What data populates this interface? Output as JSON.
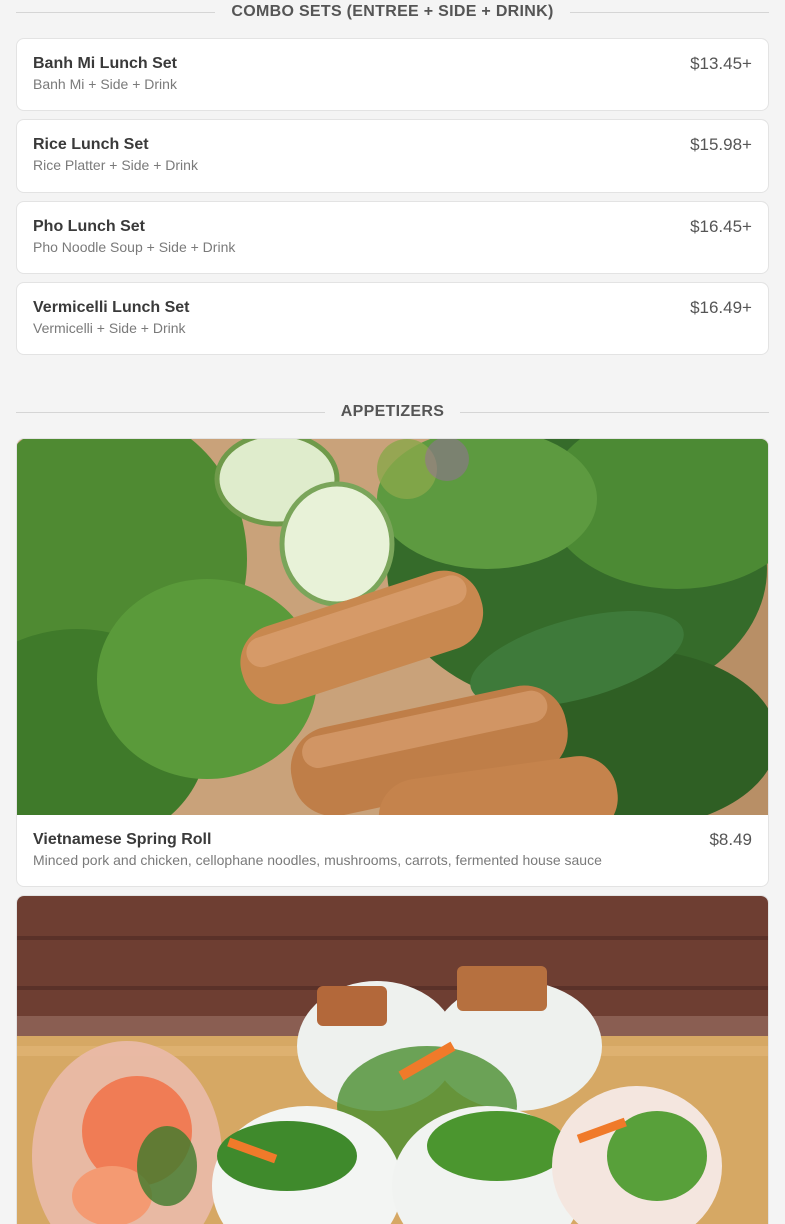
{
  "sections": {
    "combo": {
      "title": "COMBO SETS (ENTREE + SIDE + DRINK)"
    },
    "appetizers": {
      "title": "APPETIZERS"
    }
  },
  "combo_items": [
    {
      "name": "Banh Mi Lunch Set",
      "description": "Banh Mi + Side + Drink",
      "price": "$13.45+"
    },
    {
      "name": "Rice Lunch Set",
      "description": "Rice Platter + Side + Drink",
      "price": "$15.98+"
    },
    {
      "name": "Pho Lunch Set",
      "description": "Pho Noodle Soup + Side + Drink",
      "price": "$16.45+"
    },
    {
      "name": "Vermicelli Lunch Set",
      "description": "Vermicelli + Side + Drink",
      "price": "$16.49+"
    }
  ],
  "appetizer_items": [
    {
      "name": "Vietnamese Spring Roll",
      "description": "Minced pork and chicken, cellophane noodles, mushrooms, carrots, fermented house sauce",
      "price": "$8.49",
      "image": "fried-spring-rolls-photo"
    },
    {
      "image": "fresh-summer-rolls-photo"
    }
  ],
  "colors": {
    "background": "#f4f4f4",
    "card": "#ffffff",
    "title_text": "#3a3a3a",
    "desc_text": "#7a7a7a"
  }
}
